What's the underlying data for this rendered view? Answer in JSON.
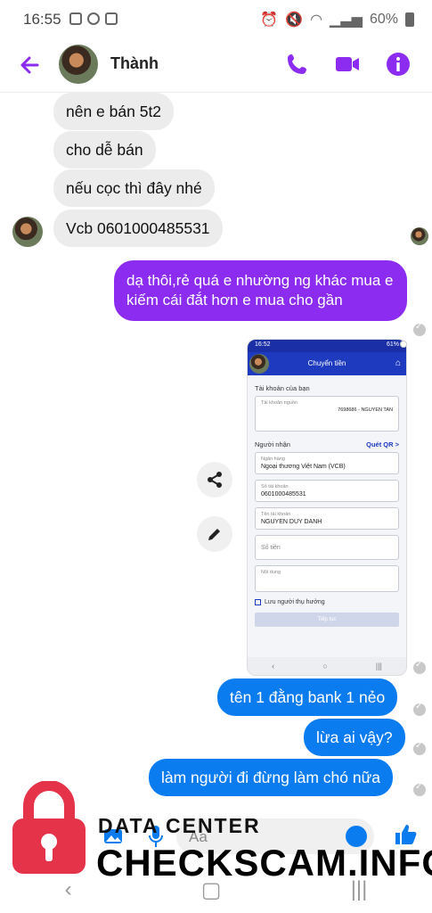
{
  "status_bar": {
    "time": "16:55",
    "battery": "60%"
  },
  "header": {
    "contact_name": "Thành"
  },
  "messages": {
    "m1": "nên e bán 5t2",
    "m2": "cho dễ bán",
    "m3": "nếu cọc thì đây nhé",
    "m4": "Vcb 0601000485531",
    "m5": "dạ thôi,rẻ quá e nhường ng khác mua e kiếm cái đắt hơn e mua cho gần",
    "m6": "tên 1 đằng bank 1 nẻo",
    "m7": "lừa ai vậy?",
    "m8": "làm người đi đừng làm chó nữa"
  },
  "shared_screenshot": {
    "status_time": "16:52",
    "status_battery": "61%",
    "title": "Chuyển tiền",
    "your_account_label": "Tài khoản của bạn",
    "your_account_caption": "Tài khoản nguồn",
    "your_account_value": "7698686 - NGUYEN TAN",
    "recipient_label": "Người nhận",
    "qr_label": "Quét QR >",
    "bank_caption": "Ngân hàng",
    "bank_value": "Ngoại thương Việt Nam (VCB)",
    "account_number_caption": "Số tài khoản",
    "account_number_value": "0601000485531",
    "account_name_caption": "Tên tài khoản",
    "account_name_value": "NGUYEN DUY DANH",
    "amount_placeholder": "Số tiền",
    "content_caption": "Nội dung",
    "save_recipient": "Lưu người thụ hưởng",
    "continue_button": "Tiếp tục"
  },
  "composer": {
    "placeholder": "Aa"
  },
  "watermark": {
    "small": "DATA CENTER",
    "big": "CHECKSCAM.INFO"
  },
  "colors": {
    "accent": "#8b2cf0",
    "outgoing": "#0b7cf0",
    "incoming": "#ececec"
  },
  "icons": [
    "arrow-back-icon",
    "phone-icon",
    "video-icon",
    "info-icon",
    "share-icon",
    "edit-icon",
    "gallery-icon",
    "mic-icon",
    "emoji-icon",
    "like-icon",
    "lock-icon"
  ]
}
